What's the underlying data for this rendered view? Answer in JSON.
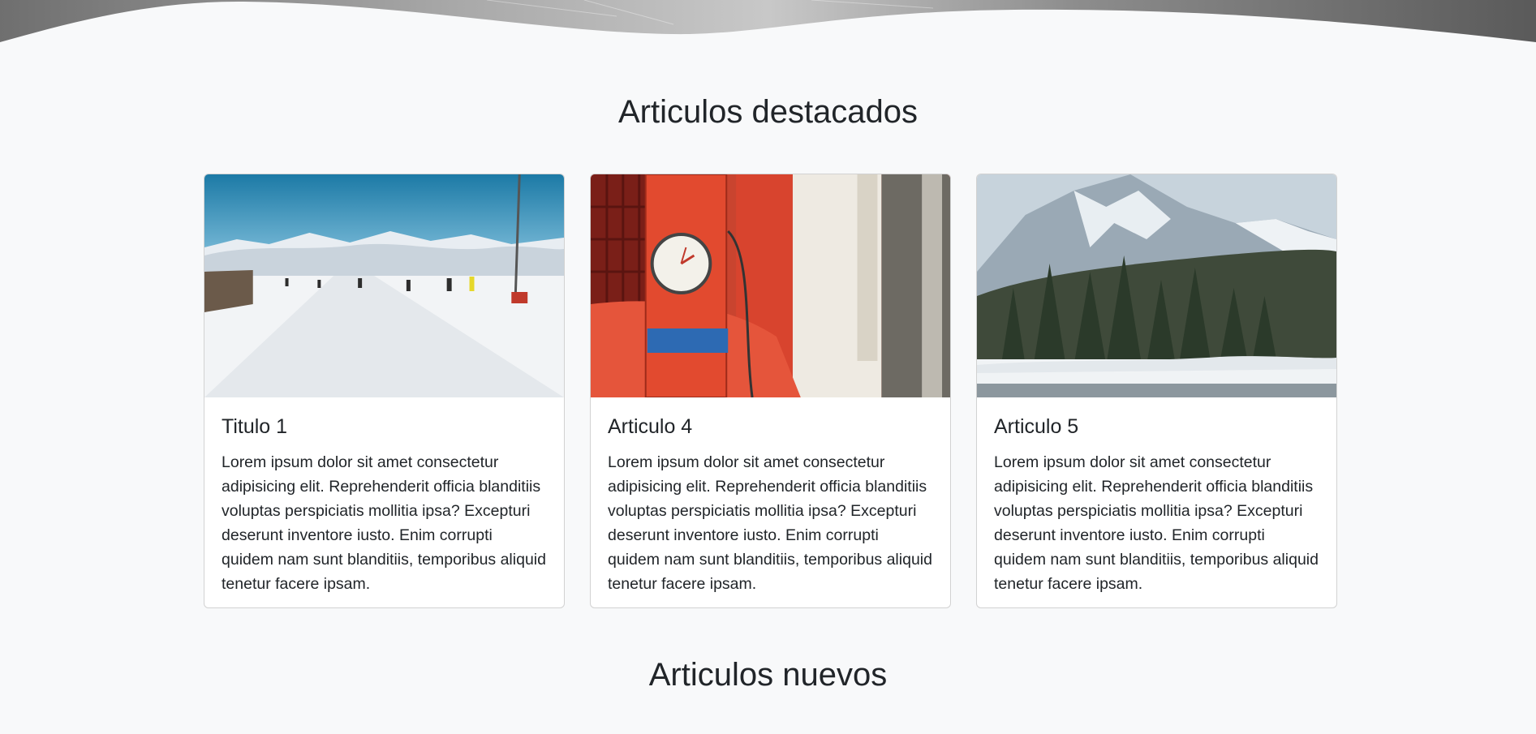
{
  "sections": {
    "featured_title": "Articulos destacados",
    "new_title": "Articulos nuevos"
  },
  "cards": [
    {
      "title": "Titulo 1",
      "text": "Lorem ipsum dolor sit amet consectetur adipisicing elit. Reprehenderit officia blanditiis voluptas perspiciatis mollitia ipsa? Excepturi deserunt inventore iusto. Enim corrupti quidem nam sunt blanditiis, temporibus aliquid tenetur facere ipsam.",
      "image": "ski-slope-photo"
    },
    {
      "title": "Articulo 4",
      "text": "Lorem ipsum dolor sit amet consectetur adipisicing elit. Reprehenderit officia blanditiis voluptas perspiciatis mollitia ipsa? Excepturi deserunt inventore iusto. Enim corrupti quidem nam sunt blanditiis, temporibus aliquid tenetur facere ipsam.",
      "image": "vintage-gas-pump-photo"
    },
    {
      "title": "Articulo 5",
      "text": "Lorem ipsum dolor sit amet consectetur adipisicing elit. Reprehenderit officia blanditiis voluptas perspiciatis mollitia ipsa? Excepturi deserunt inventore iusto. Enim corrupti quidem nam sunt blanditiis, temporibus aliquid tenetur facere ipsam.",
      "image": "snowy-mountain-forest-photo"
    }
  ],
  "colors": {
    "page_background": "#f8f9fa",
    "card_background": "#ffffff",
    "text": "#212529"
  }
}
